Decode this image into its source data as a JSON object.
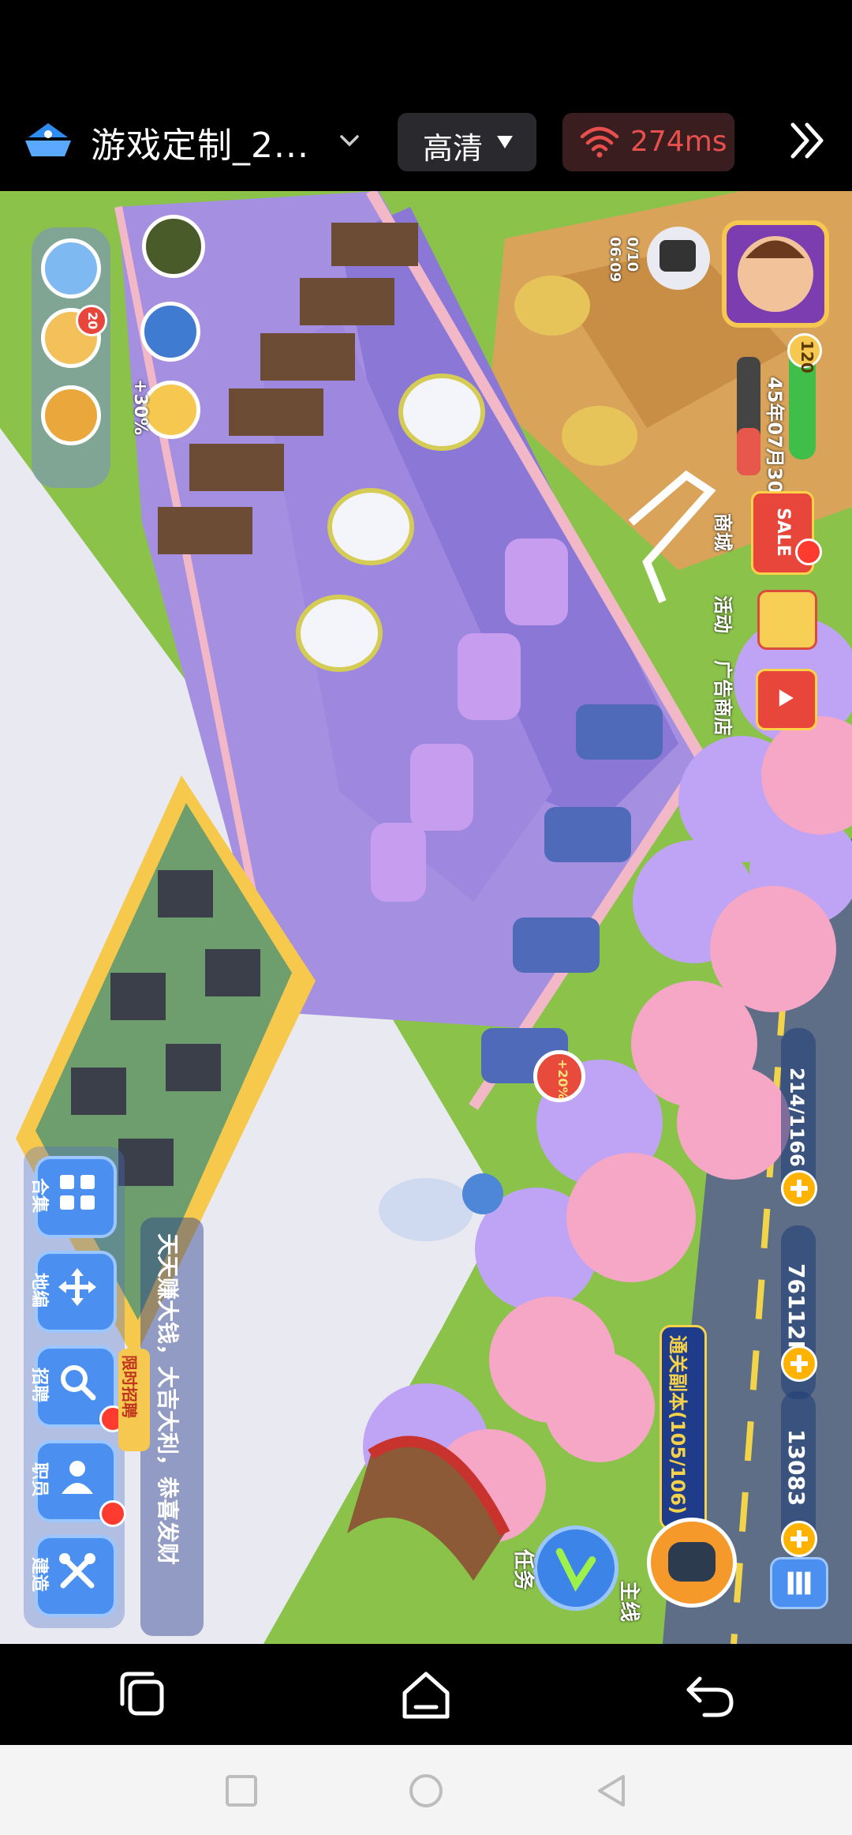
{
  "topbar": {
    "title": "游戏定制_2...",
    "quality_label": "高清",
    "latency": "274ms"
  },
  "colors": {
    "latency_red": "#e8504e",
    "hud_blue": "#4b8ff0",
    "grass": "#8bc34a",
    "floor_purple": "#8b78d6",
    "sakura_pink": "#f6a7c6"
  },
  "game": {
    "timer": {
      "count": "0/10",
      "time": "06:09"
    },
    "level": "120",
    "date": "45年07月30日",
    "shop": {
      "sale_badge": "SALE",
      "shop_label": "商城",
      "activity_label": "活动",
      "ad_shop_label": "广告商店"
    },
    "left_hud": {
      "badge_count": "20",
      "bonus": "+30%"
    },
    "resources": {
      "staff": "214/1166",
      "money": "76112K",
      "gems": "13083"
    },
    "quest_tag": "通关副本(105/106)",
    "bubble_bonus": "+20%",
    "bottom_buttons": [
      {
        "id": "hall",
        "label": "合集"
      },
      {
        "id": "edit",
        "label": "地编"
      },
      {
        "id": "recruit",
        "label": "招聘"
      },
      {
        "id": "staff",
        "label": "职员"
      },
      {
        "id": "build",
        "label": "建造"
      }
    ],
    "recruit_badge": "限时招聘",
    "ticker": "天天赚大钱，大吉大利，恭喜发财",
    "mission_label": "任务",
    "mainline_label": "主线",
    "menu_icon": "grid-menu-icon"
  },
  "nav": {
    "recent": "recent-apps-icon",
    "home": "home-icon",
    "back": "back-icon"
  }
}
